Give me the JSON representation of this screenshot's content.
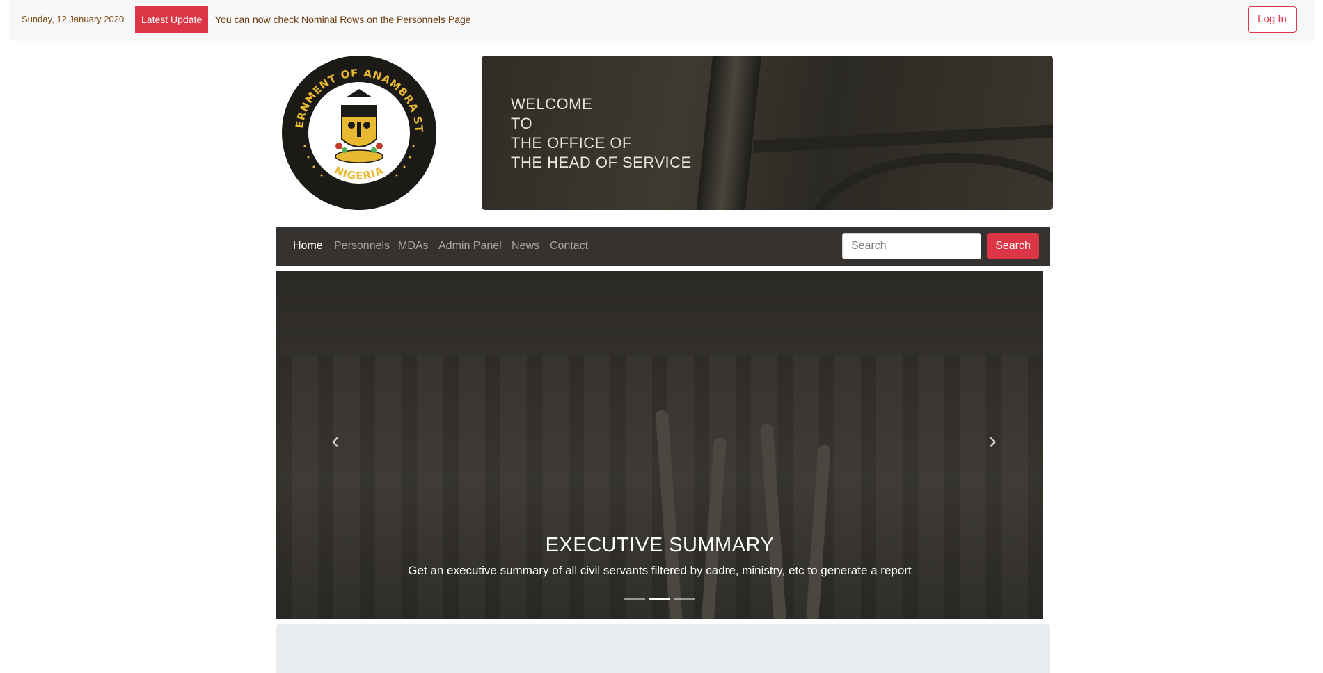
{
  "topbar": {
    "date": "Sunday, 12 January 2020",
    "badge": "Latest Update",
    "ticker": "You can now check Nominal Rows on the Personnels Page",
    "login_label": "Log In"
  },
  "seal": {
    "top_text": "GOVERNMENT OF ANAMBRA STATE",
    "bottom_text": "NIGERIA"
  },
  "hero": {
    "welcome_lines": [
      "WELCOME",
      "TO",
      "THE OFFICE OF",
      "THE HEAD OF SERVICE"
    ]
  },
  "navbar": {
    "items": [
      {
        "label": "Home",
        "active": true
      },
      {
        "label": "Personnels",
        "active": false
      },
      {
        "label": "MDAs",
        "active": false
      },
      {
        "label": "Admin Panel",
        "active": false
      },
      {
        "label": "News",
        "active": false
      },
      {
        "label": "Contact",
        "active": false
      }
    ],
    "search_placeholder": "Search",
    "search_button": "Search"
  },
  "carousel": {
    "prev_icon": "‹",
    "next_icon": "›",
    "caption_title": "EXECUTIVE SUMMARY",
    "caption_text": "Get an executive summary of all civil servants filtered by cadre, ministry, etc to generate a report",
    "slide_count": 3,
    "active_index": 1
  },
  "colors": {
    "accent": "#dc3545",
    "navbar_bg": "#353230",
    "seal_gold": "#e8b931"
  }
}
